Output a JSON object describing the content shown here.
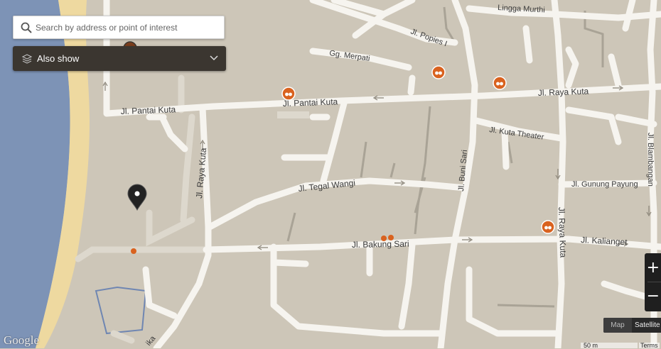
{
  "search": {
    "placeholder": "Search by address or point of interest"
  },
  "also_show": {
    "label": "Also show"
  },
  "streets": [
    "Jl. Pantai Kuta",
    "Jl. Pantai Kuta",
    "Jl. Raya Kuta",
    "Jl. Raya Kuta",
    "Jl. Raya Kuta",
    "Gg. Merpati",
    "Jl. Popies I",
    "Lingga Murthi",
    "Jl. Kuta Theater",
    "Jl. Tegal Wangi",
    "Jl. Buni Sari",
    "Jl. Gunung Payung",
    "Jl. Blambangan",
    "Jl. Bakung Sari",
    "Jl. Kalianget",
    "ika"
  ],
  "map_type": {
    "map_label": "Map",
    "satellite_label": "Satellite"
  },
  "zoom": {
    "in_label": "+",
    "out_label": "−"
  },
  "attribution": {
    "logo": "Google",
    "scale": "50 m",
    "terms": "Terms"
  },
  "colors": {
    "land": "#cdc6b8",
    "road": "#f6f4ef",
    "water": "#7d93b6",
    "beach": "#eed9a0",
    "poi_marker": "#d9621f",
    "location_pin": "#222222",
    "control_dark": "#3b3630"
  },
  "markers": {
    "location_pin": "map-pin-icon",
    "poi": "binoculars-icon",
    "small_poi": "dot-icon"
  }
}
